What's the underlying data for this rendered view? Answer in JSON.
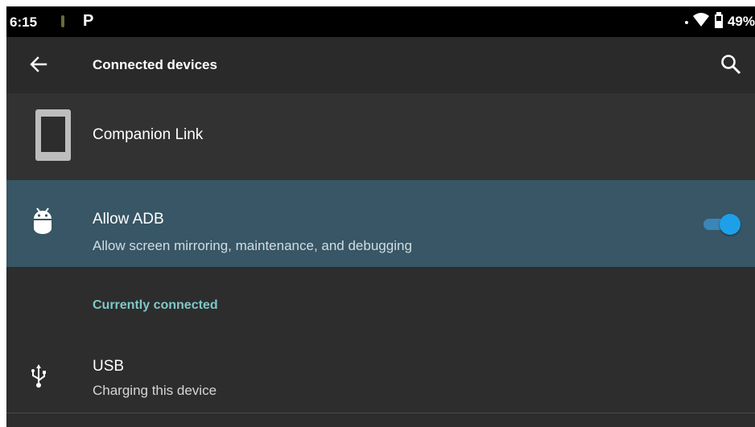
{
  "status_bar": {
    "time": "6:15",
    "notification_icons": [
      "notification-icon",
      "p-app-icon"
    ],
    "p_glyph": "P",
    "battery_percent": "49%",
    "status_icons": [
      "signal-dot-icon",
      "wifi-icon",
      "battery-icon"
    ]
  },
  "app_bar": {
    "title": "Connected devices",
    "back_icon": "arrow-back-icon",
    "search_icon": "search-icon"
  },
  "companion": {
    "title": "Companion Link",
    "icon": "tablet-icon"
  },
  "adb": {
    "title": "Allow ADB",
    "subtitle": "Allow screen mirroring, maintenance, and debugging",
    "icon": "android-icon",
    "toggle_on": true
  },
  "section": {
    "header": "Currently connected"
  },
  "usb": {
    "title": "USB",
    "subtitle": "Charging this device",
    "icon": "usb-icon"
  },
  "colors": {
    "background": "#2d2d2d",
    "highlight_row": "#385665",
    "accent_teal": "#7ec8c8",
    "toggle_thumb": "#1ea0e8",
    "toggle_track": "#3a86b8"
  }
}
